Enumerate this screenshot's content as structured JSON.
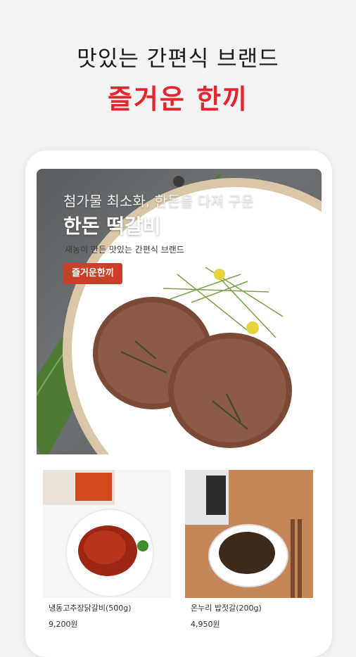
{
  "hero": {
    "line1": "맛있는 간편식 브랜드",
    "line2": "즐거운 한끼"
  },
  "banner": {
    "subtitle": "첨가물 최소화, 한돈을 다져 구운",
    "title": "한돈 떡갈비",
    "description": "새농이 만든 맛있는 간편식 브랜드",
    "button_label": "즐거운한끼"
  },
  "products": [
    {
      "name": "냉동고추장닭갈비(500g)",
      "price": "9,200원"
    },
    {
      "name": "온누리 밥젓갈(200g)",
      "price": "4,950원"
    }
  ],
  "colors": {
    "brand_red": "#e4262c",
    "button_red": "#c93f2a",
    "background": "#f2f3f5"
  }
}
